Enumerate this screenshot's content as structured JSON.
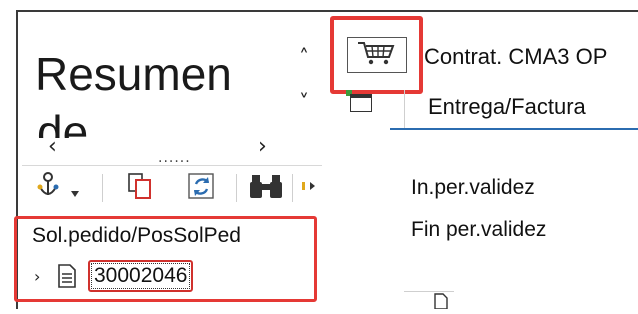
{
  "panel": {
    "title_line1": "Resumen",
    "title_line2": "de",
    "nav_prev": "‹",
    "nav_next": "›",
    "sort_up": "˄",
    "sort_down": "˅",
    "dots": "......"
  },
  "toolbar": {
    "buttons": [
      {
        "name": "document-flow",
        "icon": "flow-icon"
      },
      {
        "name": "copy",
        "icon": "copy-icon"
      },
      {
        "name": "refresh",
        "icon": "refresh-icon"
      },
      {
        "name": "find",
        "icon": "binoculars-icon"
      },
      {
        "name": "more",
        "icon": "more-icon"
      }
    ]
  },
  "tree": {
    "header": "Sol.pedido/PosSolPed",
    "node_id": "30002046",
    "expander": "›"
  },
  "detail": {
    "header_top": "Contrat. CMA3 OP",
    "tab_label": "Entrega/Factura",
    "fields": [
      {
        "label": "In.per.validez"
      },
      {
        "label": "Fin per.validez"
      }
    ]
  },
  "colors": {
    "highlight": "#e53935",
    "tab_underline": "#2b6cb0"
  }
}
